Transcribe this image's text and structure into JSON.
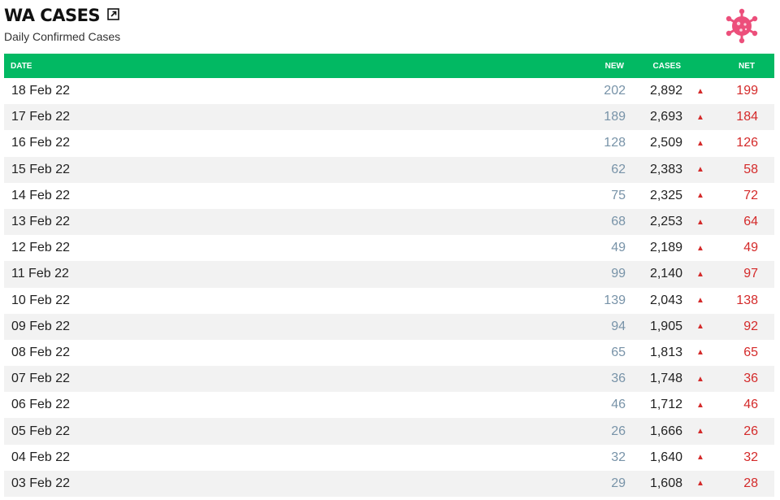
{
  "header": {
    "title": "WA CASES",
    "subtitle": "Daily Confirmed Cases",
    "popout_icon": "external-link-icon",
    "logo_icon": "virus-icon"
  },
  "colors": {
    "header_bg": "#02b963",
    "new_text": "#7893a8",
    "net_text": "#d42a2a",
    "virus": "#ec4f7b"
  },
  "table": {
    "columns": {
      "date": "DATE",
      "new": "NEW",
      "cases": "CASES",
      "net": "NET"
    },
    "rows": [
      {
        "date": "18 Feb 22",
        "new": "202",
        "cases": "2,892",
        "arrow": "▲",
        "net": "199"
      },
      {
        "date": "17 Feb 22",
        "new": "189",
        "cases": "2,693",
        "arrow": "▲",
        "net": "184"
      },
      {
        "date": "16 Feb 22",
        "new": "128",
        "cases": "2,509",
        "arrow": "▲",
        "net": "126"
      },
      {
        "date": "15 Feb 22",
        "new": "62",
        "cases": "2,383",
        "arrow": "▲",
        "net": "58"
      },
      {
        "date": "14 Feb 22",
        "new": "75",
        "cases": "2,325",
        "arrow": "▲",
        "net": "72"
      },
      {
        "date": "13 Feb 22",
        "new": "68",
        "cases": "2,253",
        "arrow": "▲",
        "net": "64"
      },
      {
        "date": "12 Feb 22",
        "new": "49",
        "cases": "2,189",
        "arrow": "▲",
        "net": "49"
      },
      {
        "date": "11 Feb 22",
        "new": "99",
        "cases": "2,140",
        "arrow": "▲",
        "net": "97"
      },
      {
        "date": "10 Feb 22",
        "new": "139",
        "cases": "2,043",
        "arrow": "▲",
        "net": "138"
      },
      {
        "date": "09 Feb 22",
        "new": "94",
        "cases": "1,905",
        "arrow": "▲",
        "net": "92"
      },
      {
        "date": "08 Feb 22",
        "new": "65",
        "cases": "1,813",
        "arrow": "▲",
        "net": "65"
      },
      {
        "date": "07 Feb 22",
        "new": "36",
        "cases": "1,748",
        "arrow": "▲",
        "net": "36"
      },
      {
        "date": "06 Feb 22",
        "new": "46",
        "cases": "1,712",
        "arrow": "▲",
        "net": "46"
      },
      {
        "date": "05 Feb 22",
        "new": "26",
        "cases": "1,666",
        "arrow": "▲",
        "net": "26"
      },
      {
        "date": "04 Feb 22",
        "new": "32",
        "cases": "1,640",
        "arrow": "▲",
        "net": "32"
      },
      {
        "date": "03 Feb 22",
        "new": "29",
        "cases": "1,608",
        "arrow": "▲",
        "net": "28"
      }
    ]
  }
}
